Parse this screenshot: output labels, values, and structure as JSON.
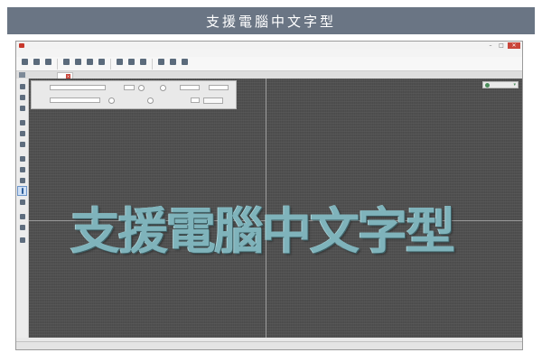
{
  "banner": {
    "title": "支援電腦中文字型"
  },
  "window": {
    "title": "",
    "minimize": "–",
    "maximize": "□",
    "close": "✕"
  },
  "menu": [
    {
      "label": ""
    },
    {
      "label": ""
    },
    {
      "label": ""
    },
    {
      "label": ""
    },
    {
      "label": ""
    }
  ],
  "ribbon": [
    {
      "label": "",
      "icon": "file-icon"
    },
    {
      "label": "",
      "icon": "open-icon"
    },
    {
      "label": "",
      "icon": "save-icon"
    },
    {
      "label": "",
      "icon": "undo-icon"
    },
    {
      "label": "",
      "icon": "redo-icon"
    },
    {
      "label": "",
      "icon": "text-icon"
    },
    {
      "label": "",
      "icon": "edit-icon"
    },
    {
      "label": "",
      "icon": "outline-icon"
    },
    {
      "label": "",
      "icon": "layout-icon"
    },
    {
      "label": "",
      "icon": "monogram-icon"
    },
    {
      "label": "",
      "icon": "color-icon"
    },
    {
      "label": "",
      "icon": "stitch-icon"
    },
    {
      "label": "",
      "icon": "sew-icon"
    }
  ],
  "tabs": {
    "active_doc": "",
    "close": "×"
  },
  "properties": {
    "text_label": "",
    "text_value": "",
    "size_label": "",
    "size_value": "",
    "font_label": "",
    "font_value": "",
    "btn_apply": ""
  },
  "zoom": {
    "value": ""
  },
  "canvas": {
    "embroidery_text": "支援電腦中文字型"
  },
  "minipanel": {
    "row1_icon": "/",
    "row1_box": "✕",
    "row2_icon": "●",
    "row2_box": "✕"
  },
  "page": {
    "label": ""
  },
  "status": [
    "",
    "",
    "",
    "",
    ""
  ],
  "colors": {
    "canvas": "#515151",
    "thread": "#7fb3bb",
    "banner": "#6a7584"
  }
}
